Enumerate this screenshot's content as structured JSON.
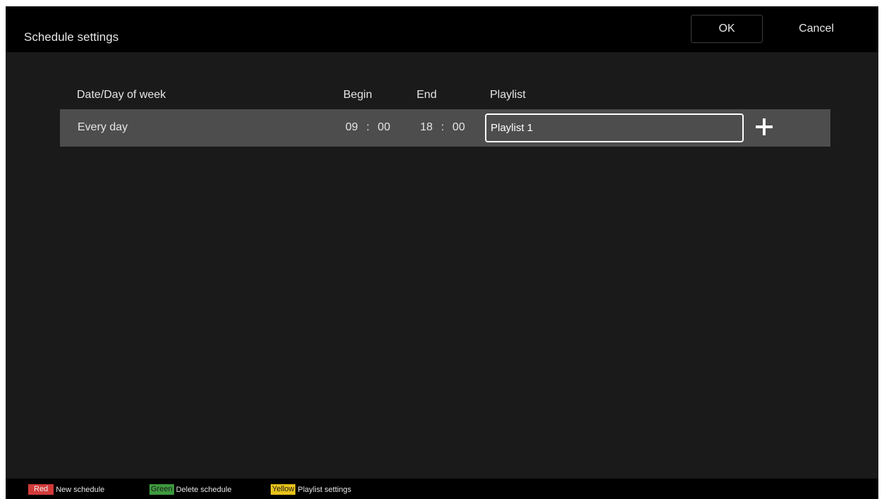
{
  "header": {
    "title": "Schedule settings",
    "ok_label": "OK",
    "cancel_label": "Cancel"
  },
  "table": {
    "columns": {
      "date": "Date/Day of week",
      "begin": "Begin",
      "end": "End",
      "playlist": "Playlist"
    },
    "rows": [
      {
        "day": "Every day",
        "begin_hour": "09",
        "begin_minute": "00",
        "end_hour": "18",
        "end_minute": "00",
        "time_separator": ":",
        "playlist": "Playlist 1",
        "add_icon": "plus-icon"
      }
    ]
  },
  "footer": {
    "hints": [
      {
        "key": "Red",
        "label": "New schedule",
        "color": "#d23a3a"
      },
      {
        "key": "Green",
        "label": "Delete schedule",
        "color": "#3e9a3e"
      },
      {
        "key": "Yellow",
        "label": "Playlist settings",
        "color": "#e8c21a"
      }
    ]
  }
}
